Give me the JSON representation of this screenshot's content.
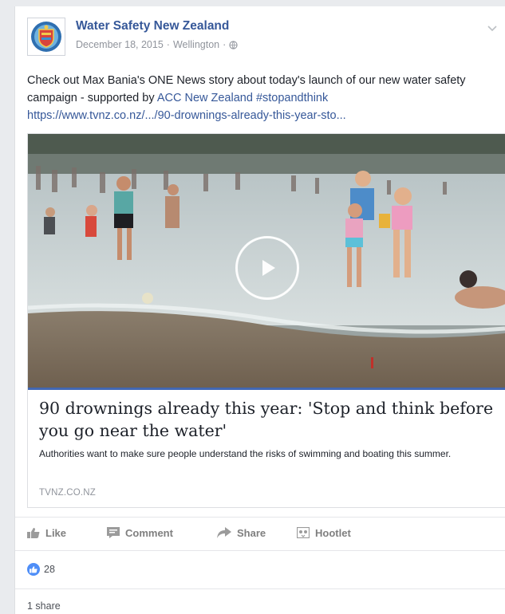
{
  "post": {
    "page_name": "Water Safety New Zealand",
    "date": "December 18, 2015",
    "location": "Wellington",
    "separator": "·",
    "text_before": "Check out Max Bania's ONE News story about today's launch of our new water safety campaign - supported by ",
    "mention": "ACC New Zealand",
    "hashtag": "#stopandthink",
    "url": "https://www.tvnz.co.nz/.../90-drownings-already-this-year-sto..."
  },
  "attachment": {
    "title": "90 drownings already this year: 'Stop and think before you go near the water'",
    "description": "Authorities want to make sure people understand the risks of swimming and boating this summer.",
    "domain": "TVNZ.CO.NZ"
  },
  "actions": {
    "like": "Like",
    "comment": "Comment",
    "share": "Share",
    "hootlet": "Hootlet"
  },
  "stats": {
    "likes": "28",
    "shares": "1 share"
  },
  "icons": {
    "avatar": "crest-logo",
    "privacy": "globe-icon",
    "menu": "chevron-down-icon",
    "play": "play-icon",
    "like": "thumbs-up-icon",
    "comment": "comment-icon",
    "share": "share-arrow-icon",
    "hootlet": "hootlet-icon"
  },
  "colors": {
    "link": "#365899",
    "meta": "#90949c",
    "action": "#7f7f7f",
    "accent": "#4267b2",
    "like_badge": "#4f8ef7"
  }
}
